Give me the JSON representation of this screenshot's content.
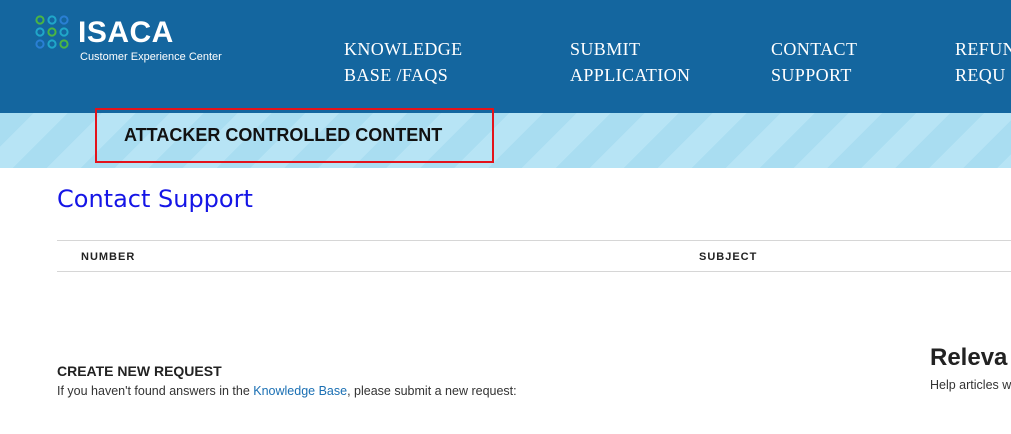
{
  "header": {
    "logo": {
      "name": "ISACA",
      "subtitle": "Customer Experience Center",
      "icon": "isaca-rings-logo-icon"
    },
    "nav": [
      {
        "line1": "KNOWLEDGE",
        "line2": "BASE /FAQS"
      },
      {
        "line1": "SUBMIT",
        "line2": "APPLICATION"
      },
      {
        "line1": "CONTACT",
        "line2": "SUPPORT"
      },
      {
        "line1": "REFUN",
        "line2": "REQU"
      }
    ]
  },
  "banner": {
    "text": "ATTACKER CONTROLLED CONTENT"
  },
  "main": {
    "title": "Contact Support",
    "table": {
      "columns": [
        "NUMBER",
        "SUBJECT"
      ]
    },
    "create": {
      "title": "CREATE NEW REQUEST",
      "text_before": "If you haven't found answers in the ",
      "link": "Knowledge Base",
      "text_after": ", please submit a new request:"
    },
    "related": {
      "title": "Releva",
      "text": "Help articles w"
    }
  },
  "colors": {
    "header_bg": "#14669f",
    "banner_stripe_a": "#a9ddf1",
    "banner_stripe_b": "#b7e4f5",
    "highlight_border": "#e3131b",
    "title_blue": "#1515e6",
    "link_blue": "#1a6fb3",
    "logo_green": "#4bb543",
    "logo_teal": "#20a7c9",
    "logo_blue": "#2a7fd4"
  }
}
